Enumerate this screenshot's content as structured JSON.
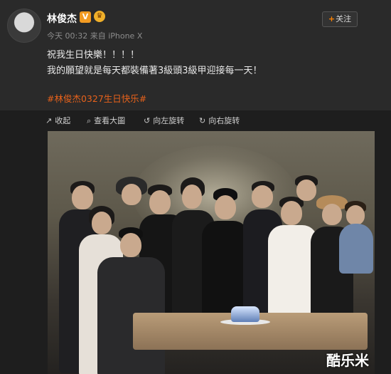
{
  "post": {
    "author": "林俊杰",
    "vip_badge": "V",
    "crown_badge": "♛",
    "meta": "今天 00:32 来自 iPhone X",
    "follow_label": "关注",
    "line1": "祝我生日快樂！！！！",
    "line2": "我的願望就是每天都裝備著3級頭3級甲迎接每一天！",
    "hashtag": "#林俊杰0327生日快乐#"
  },
  "toolbar": {
    "collapse": "收起",
    "view_large": "查看大圖",
    "rotate_left": "向左旋转",
    "rotate_right": "向右旋转"
  },
  "photo": {
    "watermark": "酷乐米"
  },
  "colors": {
    "background": "#2a2a2a",
    "accent": "#ff8200",
    "hashtag": "#e8621b"
  }
}
